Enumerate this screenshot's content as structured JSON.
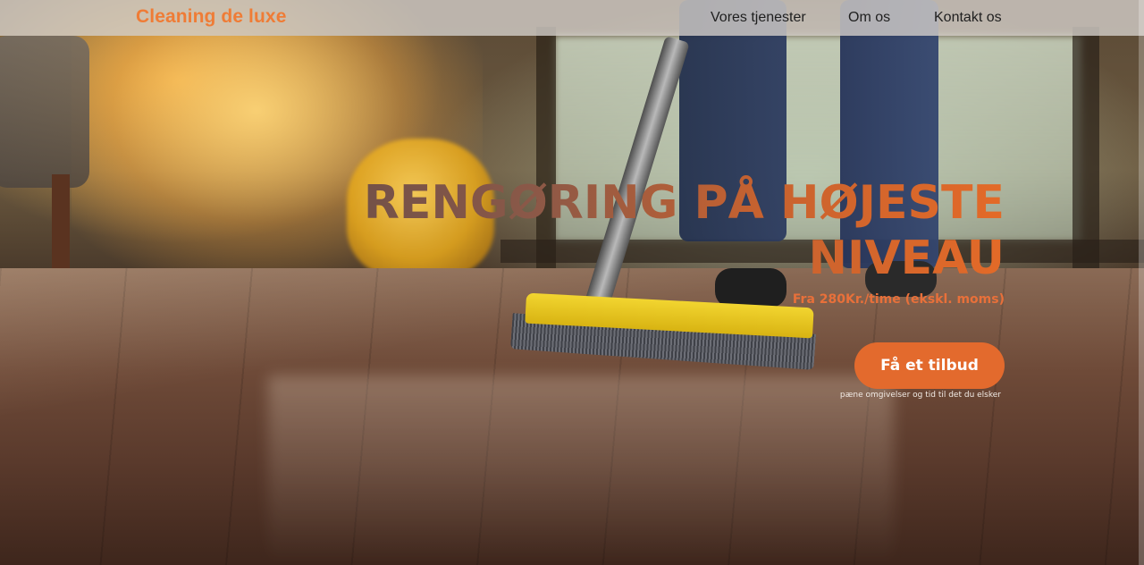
{
  "navbar": {
    "brand": "Cleaning de luxe",
    "links": [
      {
        "label": "Vores tjenester"
      },
      {
        "label": "Om os"
      },
      {
        "label": "Kontakt os"
      }
    ]
  },
  "hero": {
    "title": "RENGØRING PÅ HØJESTE NIVEAU",
    "price": "Fra 280Kr./time (ekskl. moms)",
    "cta_label": "Få et tilbud",
    "tagline": "pæne omgivelser og tid til det du elsker"
  },
  "colors": {
    "brand": "#ef7c36",
    "cta": "#e36a2d",
    "navbar_bg": "#d7d2cd"
  }
}
